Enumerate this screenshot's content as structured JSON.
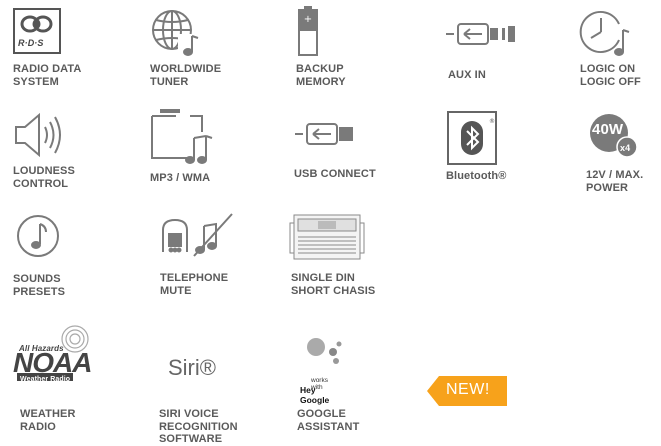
{
  "features": {
    "rds": {
      "label": "RADIO DATA\nSYSTEM",
      "logo_text": "R·D·S"
    },
    "worldwide": {
      "label": "WORLDWIDE\nTUNER"
    },
    "backup": {
      "label": "BACKUP\nMEMORY"
    },
    "aux": {
      "label": "AUX IN"
    },
    "logic": {
      "label": "LOGIC ON\nLOGIC OFF"
    },
    "loudness": {
      "label": "LOUDNESS\nCONTROL"
    },
    "mp3": {
      "label": "MP3 / WMA"
    },
    "usb": {
      "label": "USB CONNECT"
    },
    "bluetooth": {
      "label": "Bluetooth®"
    },
    "power": {
      "label": "12V / MAX.\nPOWER",
      "badge_watts": "40W",
      "badge_multiplier": "x4"
    },
    "sounds": {
      "label": "SOUNDS\nPRESETS"
    },
    "telephone": {
      "label": "TELEPHONE\nMUTE"
    },
    "din": {
      "label": "SINGLE DIN\nSHORT CHASIS"
    },
    "weather": {
      "label": "WEATHER\nRADIO",
      "logo_top": "All Hazards",
      "logo_main": "NOAA",
      "logo_sub": "Weather Radio"
    },
    "siri": {
      "label": "SIRI VOICE\nRECOGNITION\nSOFTWARE",
      "logo_text": "Siri®"
    },
    "google": {
      "label": "GOOGLE\nASSISTANT",
      "works_with": "works with",
      "hey_google": "Hey Google"
    }
  },
  "new_badge": {
    "text": "NEW!",
    "color": "#f7a21b"
  },
  "icon_color": "#7a7a7a"
}
